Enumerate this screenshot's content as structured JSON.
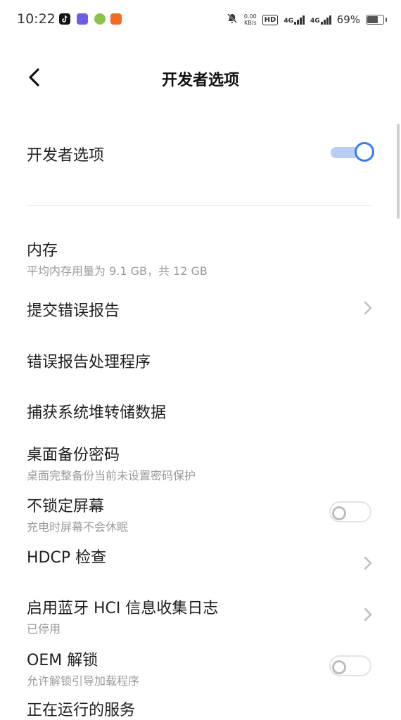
{
  "status_bar": {
    "time": "10:22",
    "net_speed_value": "0.00",
    "net_speed_unit": "KB/s",
    "hd_label": "HD",
    "net1": "4G",
    "net2": "4G",
    "battery": "69%",
    "battery_level": 0.69,
    "app_icons": [
      "tiktok-icon",
      "app-purple-icon",
      "app-green-icon",
      "app-orange-icon"
    ]
  },
  "header": {
    "title": "开发者选项"
  },
  "master": {
    "label": "开发者选项",
    "enabled": true
  },
  "items": [
    {
      "title": "内存",
      "subtitle": "平均内存用量为 9.1 GB，共 12 GB"
    },
    {
      "title": "提交错误报告"
    },
    {
      "title": "错误报告处理程序"
    },
    {
      "title": "捕获系统堆转储数据"
    },
    {
      "title": "桌面备份密码",
      "subtitle": "桌面完整备份当前未设置密码保护"
    },
    {
      "title": "不锁定屏幕",
      "subtitle": "充电时屏幕不会休眠",
      "enabled": false
    },
    {
      "title": "HDCP 检查"
    },
    {
      "title": "启用蓝牙 HCI 信息收集日志",
      "subtitle": "已停用"
    },
    {
      "title": "OEM 解锁",
      "subtitle": "允许解锁引导加载程序",
      "enabled": false
    },
    {
      "title": "正在运行的服务"
    }
  ],
  "colors": {
    "accent": "#3a7bf0",
    "text_primary": "#1f1f1f",
    "text_secondary": "#9a9a9a"
  }
}
